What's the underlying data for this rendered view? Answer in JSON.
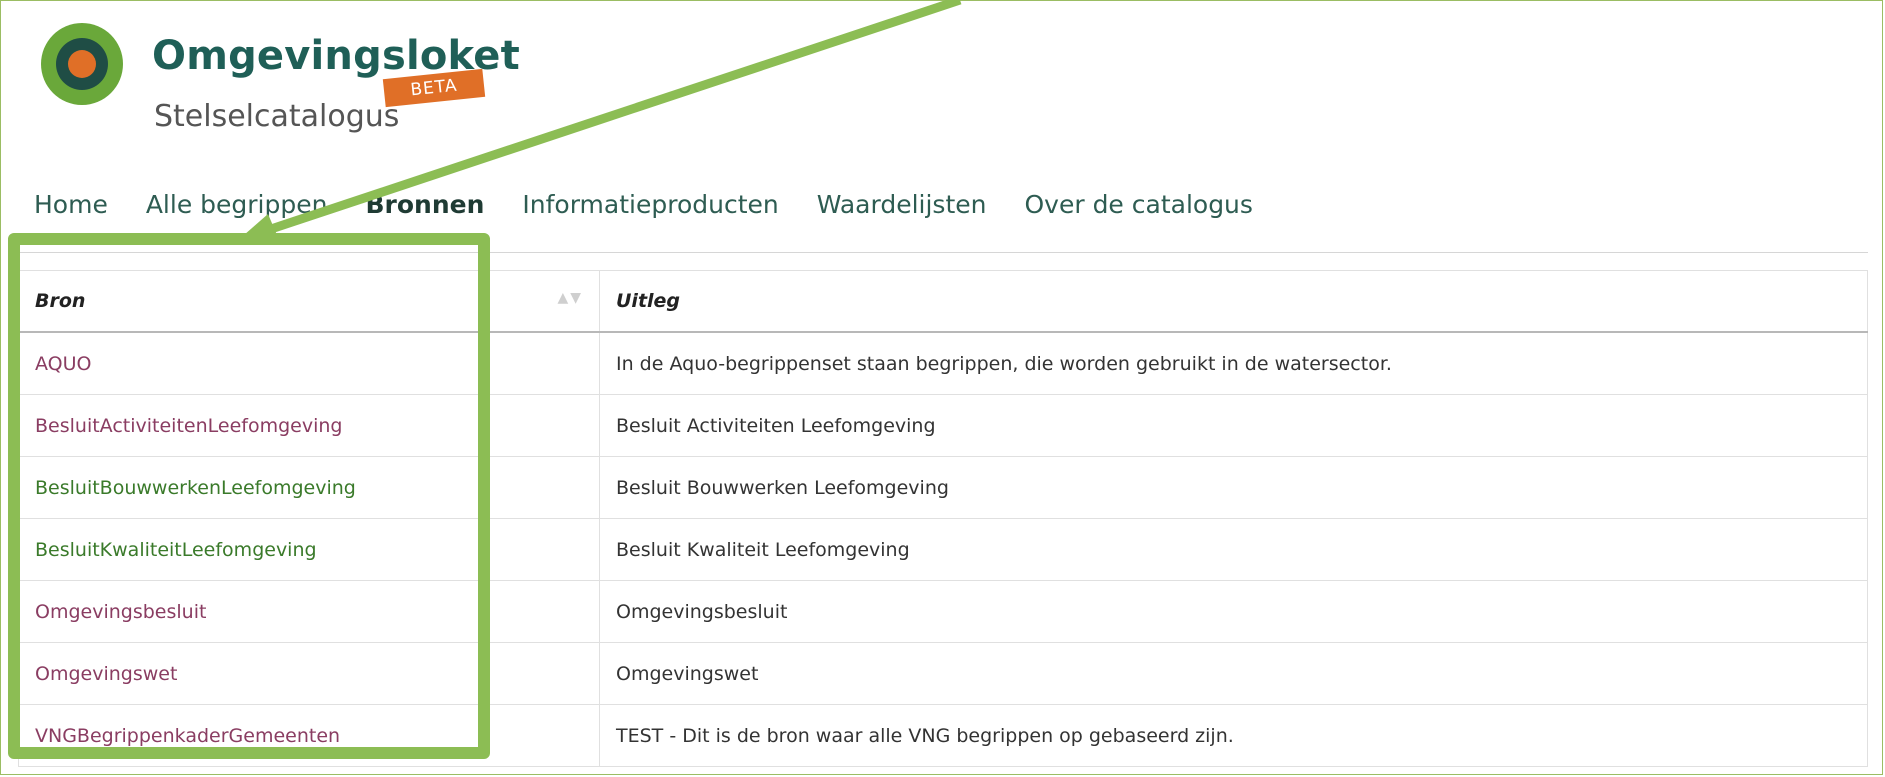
{
  "header": {
    "brand_name": "Omgevingsloket",
    "beta_label": "BETA",
    "subtitle": "Stelselcatalogus",
    "logo_icon": "omgevingsloket-logo-icon"
  },
  "nav": {
    "items": [
      {
        "label": "Home",
        "active": false
      },
      {
        "label": "Alle begrippen",
        "active": false
      },
      {
        "label": "Bronnen",
        "active": true
      },
      {
        "label": "Informatieproducten",
        "active": false
      },
      {
        "label": "Waardelijsten",
        "active": false
      },
      {
        "label": "Over de catalogus",
        "active": false
      }
    ]
  },
  "table": {
    "headers": {
      "bron": "Bron",
      "uitleg": "Uitleg",
      "sort_icon": "sort-arrows-icon"
    },
    "rows": [
      {
        "bron": "AQUO",
        "uitleg": "In de Aquo-begrippenset staan begrippen, die worden gebruikt in de watersector.",
        "link_color": "plum"
      },
      {
        "bron": "BesluitActiviteitenLeefomgeving",
        "uitleg": "Besluit Activiteiten Leefomgeving",
        "link_color": "plum"
      },
      {
        "bron": "BesluitBouwwerkenLeefomgeving",
        "uitleg": "Besluit Bouwwerken Leefomgeving",
        "link_color": "green"
      },
      {
        "bron": "BesluitKwaliteitLeefomgeving",
        "uitleg": "Besluit Kwaliteit Leefomgeving",
        "link_color": "green"
      },
      {
        "bron": "Omgevingsbesluit",
        "uitleg": "Omgevingsbesluit",
        "link_color": "plum"
      },
      {
        "bron": "Omgevingswet",
        "uitleg": "Omgevingswet",
        "link_color": "plum"
      },
      {
        "bron": "VNGBegrippenkaderGemeenten",
        "uitleg": "TEST - Dit is de bron waar alle VNG begrippen op gebaseerd zijn.",
        "link_color": "plum"
      }
    ]
  },
  "colors": {
    "brand_teal": "#1f5f57",
    "beta_orange": "#e06f27",
    "logo_green": "#6aa83a",
    "logo_dark": "#1f4d45",
    "logo_orange": "#e06f27",
    "link_plum": "#8a3d62",
    "link_green": "#3a7a2a",
    "annotation_green": "#8cbd54"
  }
}
